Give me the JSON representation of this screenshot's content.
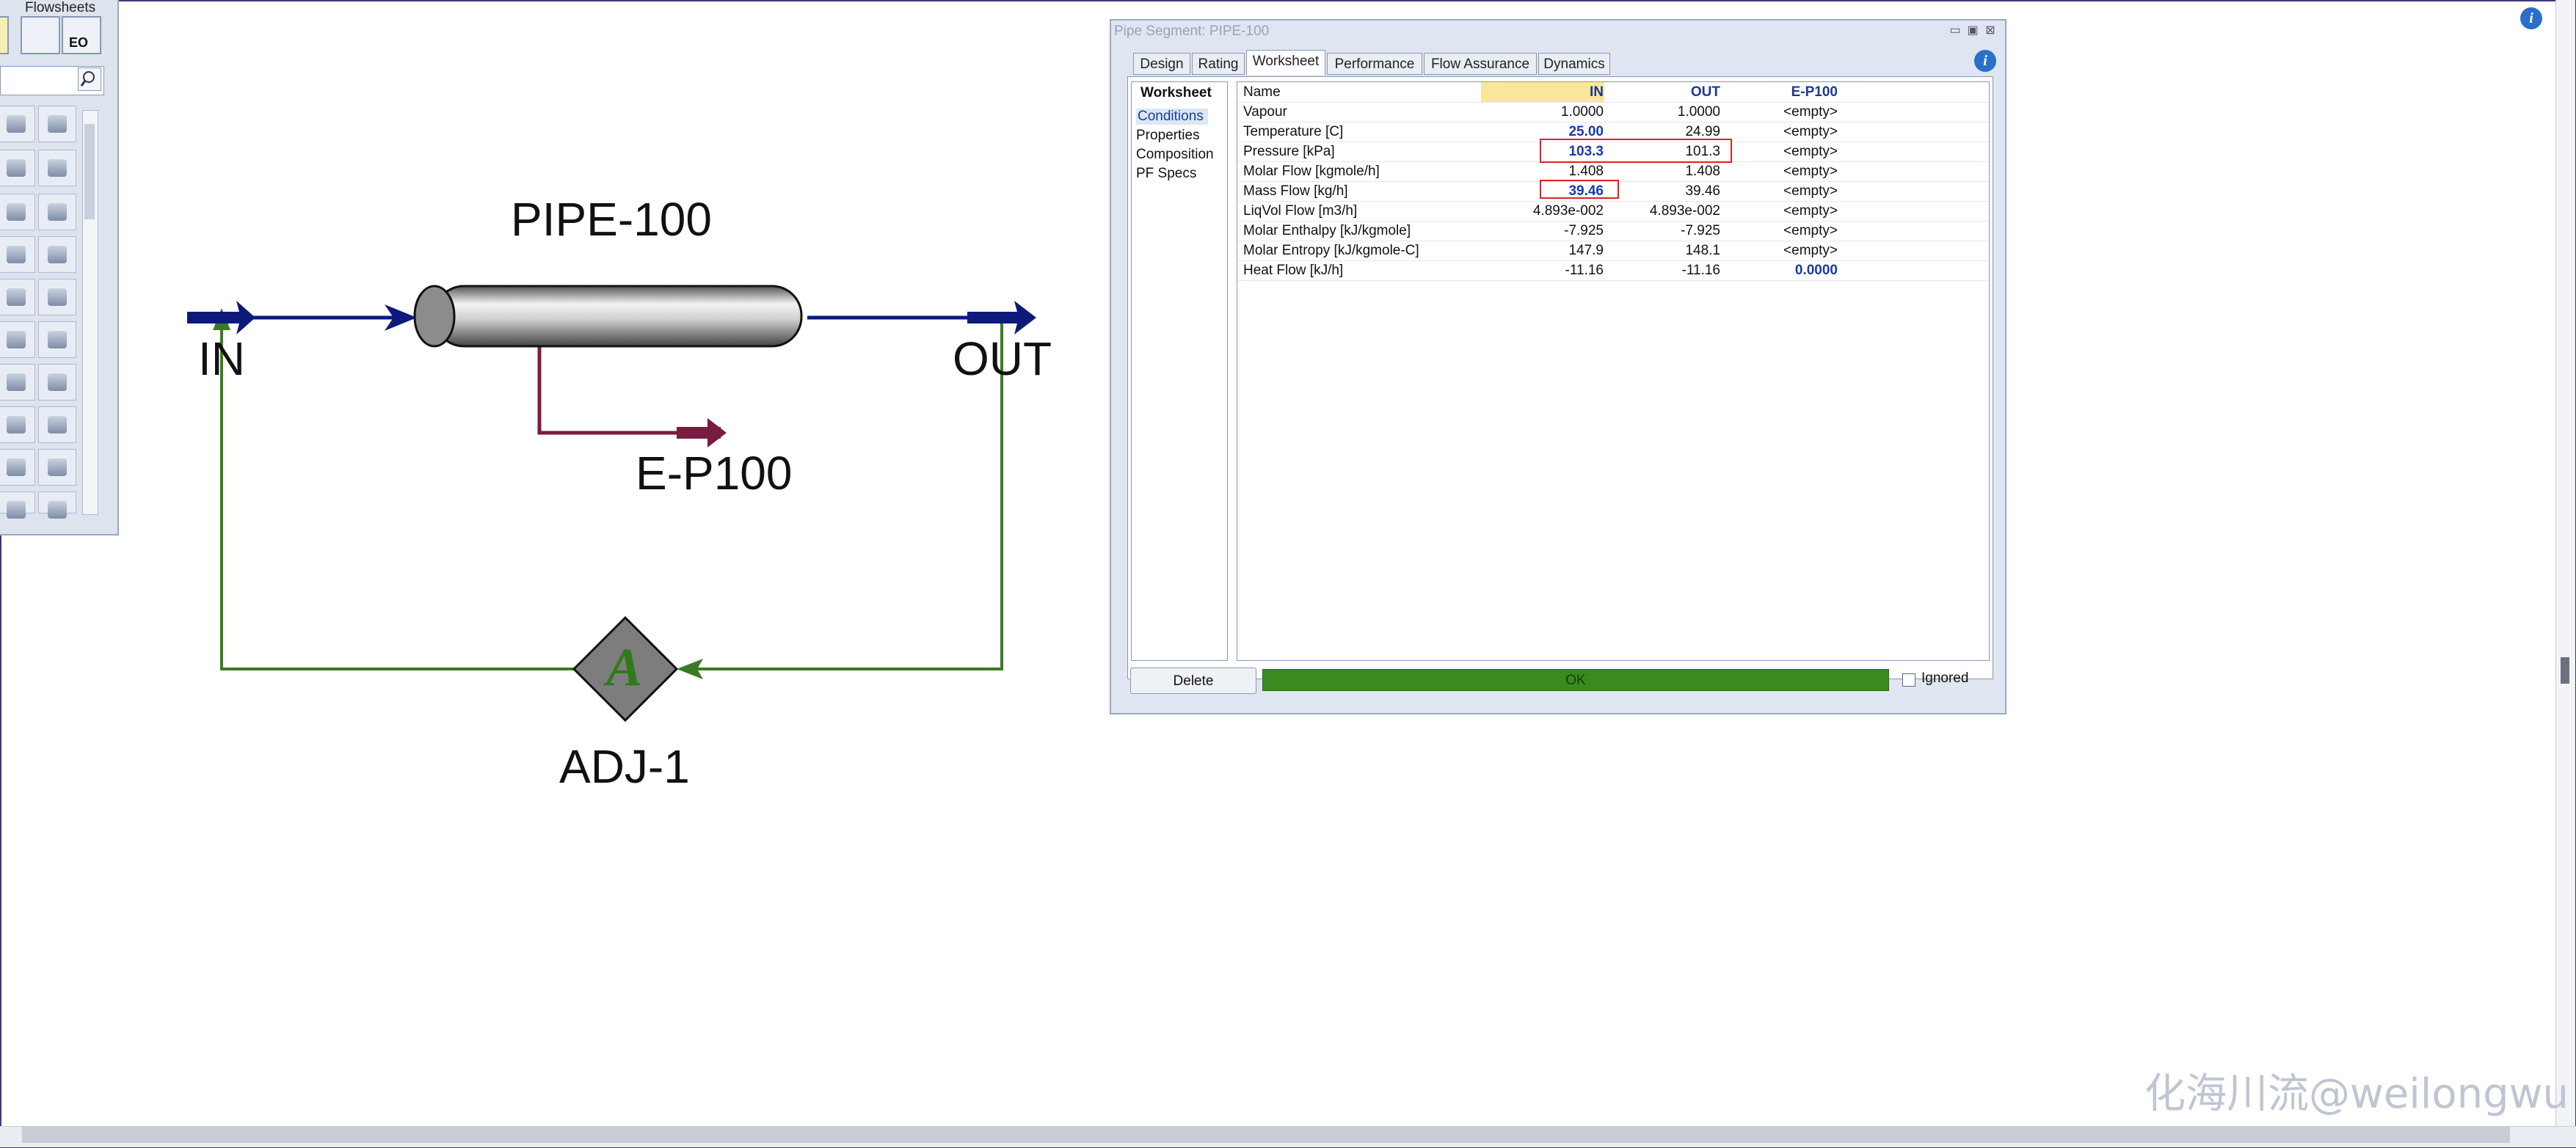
{
  "palette": {
    "title": "Flowsheets",
    "sub_icon": "EO"
  },
  "flowsheet": {
    "pipe_label": "PIPE-100",
    "stream_in": "IN",
    "stream_out": "OUT",
    "energy_label": "E-P100",
    "adjust_label": "ADJ-1",
    "adjust_symbol": "A"
  },
  "window": {
    "title": "Pipe Segment: PIPE-100",
    "tabs": [
      "Design",
      "Rating",
      "Worksheet",
      "Performance",
      "Flow Assurance",
      "Dynamics"
    ],
    "active_tab": "Worksheet",
    "sidenav": {
      "header": "Worksheet",
      "items": [
        "Conditions",
        "Properties",
        "Composition",
        "PF Specs"
      ],
      "selected": "Conditions"
    },
    "table": {
      "headers": [
        "Name",
        "IN",
        "OUT",
        "E-P100"
      ],
      "rows": [
        {
          "name": "Vapour",
          "in": "1.0000",
          "out": "1.0000",
          "ep": "<empty>"
        },
        {
          "name": "Temperature [C]",
          "in": "25.00",
          "out": "24.99",
          "ep": "<empty>"
        },
        {
          "name": "Pressure [kPa]",
          "in": "103.3",
          "out": "101.3",
          "ep": "<empty>"
        },
        {
          "name": "Molar Flow [kgmole/h]",
          "in": "1.408",
          "out": "1.408",
          "ep": "<empty>"
        },
        {
          "name": "Mass Flow [kg/h]",
          "in": "39.46",
          "out": "39.46",
          "ep": "<empty>"
        },
        {
          "name": "LiqVol Flow [m3/h]",
          "in": "4.893e-002",
          "out": "4.893e-002",
          "ep": "<empty>"
        },
        {
          "name": "Molar Enthalpy [kJ/kgmole]",
          "in": "-7.925",
          "out": "-7.925",
          "ep": "<empty>"
        },
        {
          "name": "Molar Entropy [kJ/kgmole-C]",
          "in": "147.9",
          "out": "148.1",
          "ep": "<empty>"
        },
        {
          "name": "Heat Flow [kJ/h]",
          "in": "-11.16",
          "out": "-11.16",
          "ep": "0.0000"
        }
      ]
    },
    "delete_label": "Delete",
    "status": "OK",
    "ignored_label": "Ignored"
  },
  "watermark": "化海川流@weilongwu",
  "colors": {
    "material_stream": "#0d1a7a",
    "energy_stream": "#7a1c42",
    "logic_stream": "#3b7a22",
    "status_ok": "#3b8a1f",
    "specified_value": "#1b3aa8",
    "highlight_box": "#dd2222"
  }
}
